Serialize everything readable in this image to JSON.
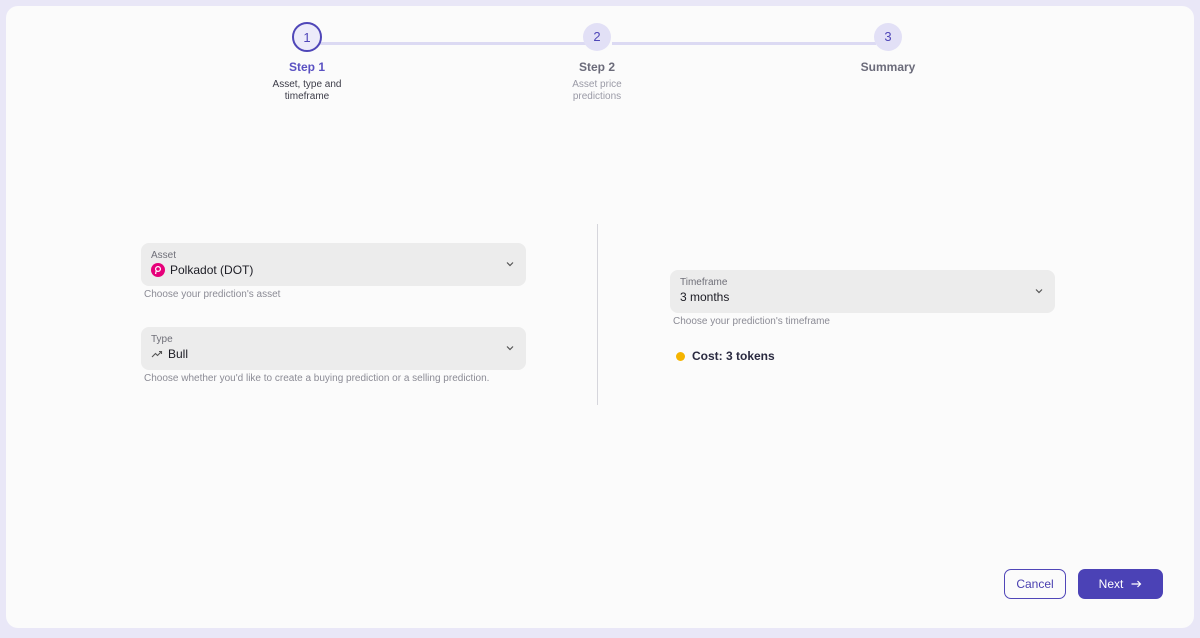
{
  "stepper": {
    "steps": [
      {
        "number": "1",
        "title": "Step 1",
        "description": "Asset, type and timeframe"
      },
      {
        "number": "2",
        "title": "Step 2",
        "description": "Asset price predictions"
      },
      {
        "number": "3",
        "title": "Summary",
        "description": ""
      }
    ],
    "active_step": 1
  },
  "form": {
    "asset": {
      "label": "Asset",
      "value": "Polkadot (DOT)",
      "helper": "Choose your prediction's asset",
      "icon": "polkadot-icon"
    },
    "type": {
      "label": "Type",
      "value": "Bull",
      "helper": "Choose whether you'd like to create a buying prediction or a selling prediction.",
      "icon": "trending-up-icon"
    },
    "timeframe": {
      "label": "Timeframe",
      "value": "3 months",
      "helper": "Choose your prediction's timeframe"
    },
    "cost": {
      "text": "Cost: 3 tokens",
      "icon": "coin-icon"
    }
  },
  "actions": {
    "cancel_label": "Cancel",
    "next_label": "Next"
  },
  "colors": {
    "accent": "#4b42b6",
    "coin": "#f5b400",
    "polkadot": "#e6007a",
    "background": "#e9e7f7"
  }
}
